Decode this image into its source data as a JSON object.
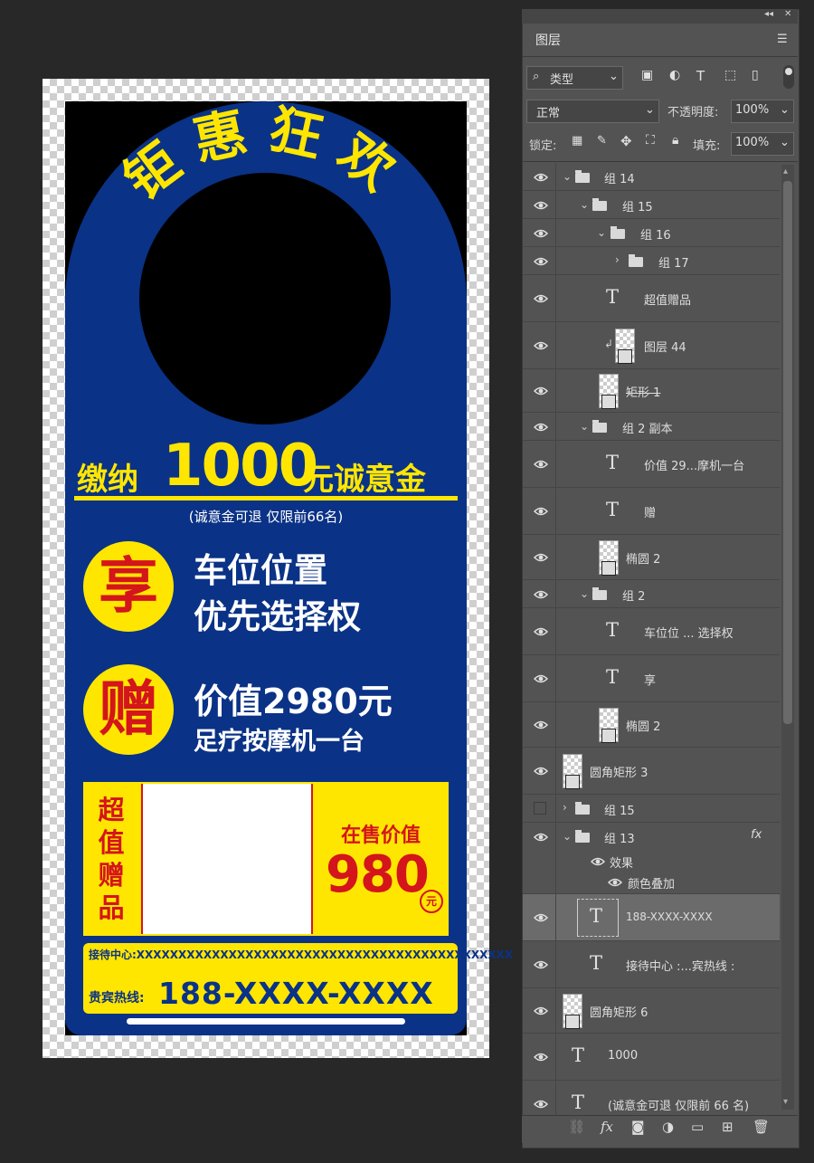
{
  "panel": {
    "tab_label": "图层",
    "filter_label": "类型",
    "blend_mode": "正常",
    "opacity_label": "不透明度:",
    "opacity_value": "100%",
    "lock_label": "锁定:",
    "fill_label": "填充:",
    "fill_value": "100%",
    "layers": [
      {
        "name": "组 14",
        "kind": "group",
        "visible": true,
        "expanded": true
      },
      {
        "name": "组 15",
        "kind": "group",
        "visible": true,
        "expanded": true
      },
      {
        "name": "组 16",
        "kind": "group",
        "visible": true,
        "expanded": true
      },
      {
        "name": "组 17",
        "kind": "group",
        "visible": true,
        "expanded": false
      },
      {
        "name": "超值赠品",
        "kind": "text",
        "visible": true
      },
      {
        "name": "图层 44",
        "kind": "pixel",
        "visible": true,
        "clipped": true
      },
      {
        "name": "矩形 1",
        "kind": "shape",
        "visible": true,
        "struck": true
      },
      {
        "name": "组 2 副本",
        "kind": "group",
        "visible": true,
        "expanded": true
      },
      {
        "name": "价值 29...摩机一台",
        "kind": "text",
        "visible": true
      },
      {
        "name": "赠",
        "kind": "text",
        "visible": true
      },
      {
        "name": "椭圆 2",
        "kind": "shape",
        "visible": true
      },
      {
        "name": "组 2",
        "kind": "group",
        "visible": true,
        "expanded": true
      },
      {
        "name": "车位位 ... 选择权",
        "kind": "text",
        "visible": true
      },
      {
        "name": "享",
        "kind": "text",
        "visible": true
      },
      {
        "name": "椭圆 2",
        "kind": "shape",
        "visible": true
      },
      {
        "name": "圆角矩形 3",
        "kind": "shape",
        "visible": true
      },
      {
        "name": "组 15",
        "kind": "group",
        "visible": false,
        "expanded": false
      },
      {
        "name": "组 13",
        "kind": "group",
        "visible": true,
        "expanded": true,
        "fx": "fx"
      },
      {
        "name": "效果",
        "kind": "effect",
        "visible": true
      },
      {
        "name": "颜色叠加",
        "kind": "effect",
        "visible": true
      },
      {
        "name": "188-XXXX-XXXX",
        "kind": "text",
        "visible": true,
        "selected": true
      },
      {
        "name": "接待中心 :...宾热线 :",
        "kind": "text",
        "visible": true
      },
      {
        "name": "圆角矩形 6",
        "kind": "shape",
        "visible": true
      },
      {
        "name": "1000",
        "kind": "text",
        "visible": true
      },
      {
        "name": "(诚意金可退 仅限前 66 名)",
        "kind": "text",
        "visible": true
      }
    ]
  },
  "design": {
    "title": "钜惠狂欢",
    "pay_prefix": "缴纳",
    "pay_amount": "1000",
    "pay_suffix": "元诚意金",
    "pay_note": "(诚意金可退  仅限前66名)",
    "perk1_icon": "享",
    "perk1_line1": "车位位置",
    "perk1_line2": "优先选择权",
    "perk2_icon": "赠",
    "perk2_line1": "价值2980元",
    "perk2_line2": "足疗按摩机一台",
    "gift_label": [
      "超",
      "值",
      "赠",
      "品"
    ],
    "sale_label": "在售价值",
    "sale_value": "980",
    "sale_unit": "元",
    "contact_line": "接待中心:XXXXXXXXXXXXXXXXXXXXXXXXXXXXXXXXXXXXXXXXXXXXX",
    "hotline_label": "贵宾热线:",
    "hotline_number": "188-XXXX-XXXX"
  },
  "colors": {
    "navy": "#0a3286",
    "yellow": "#ffe600",
    "red": "#d4151b",
    "panel_bg": "#535353",
    "workspace_bg": "#282828"
  }
}
